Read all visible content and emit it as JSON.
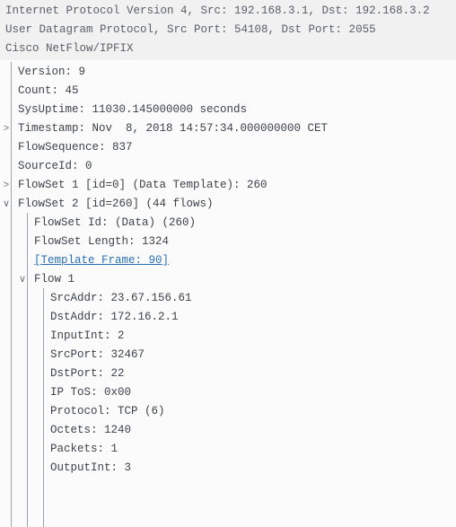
{
  "header": {
    "line1": "Internet Protocol Version 4, Src: 192.168.3.1, Dst: 192.168.3.2",
    "line2": "User Datagram Protocol, Src Port: 54108, Dst Port: 2055",
    "line3": "Cisco NetFlow/IPFIX"
  },
  "tree": {
    "version": "Version: 9",
    "count": "Count: 45",
    "sysuptime": "SysUptime: 11030.145000000 seconds",
    "timestamp": "Timestamp: Nov  8, 2018 14:57:34.000000000 CET",
    "flowsequence": "FlowSequence: 837",
    "sourceid": "SourceId: 0",
    "flowset1": "FlowSet 1 [id=0] (Data Template): 260",
    "flowset2": "FlowSet 2 [id=260] (44 flows)",
    "flowset2_children": {
      "flowset_id": "FlowSet Id: (Data) (260)",
      "flowset_length": "FlowSet Length: 1324",
      "template_frame": "[Template Frame: 90]",
      "flow1": "Flow 1",
      "flow1_children": {
        "srcaddr": "SrcAddr: 23.67.156.61",
        "dstaddr": "DstAddr: 172.16.2.1",
        "inputint": "InputInt: 2",
        "srcport": "SrcPort: 32467",
        "dstport": "DstPort: 22",
        "iptos": "IP ToS: 0x00",
        "protocol": "Protocol: TCP (6)",
        "octets": "Octets: 1240",
        "packets": "Packets: 1",
        "outputint": "OutputInt: 3"
      }
    }
  },
  "toggles": {
    "collapsed": ">",
    "expanded": "∨"
  }
}
